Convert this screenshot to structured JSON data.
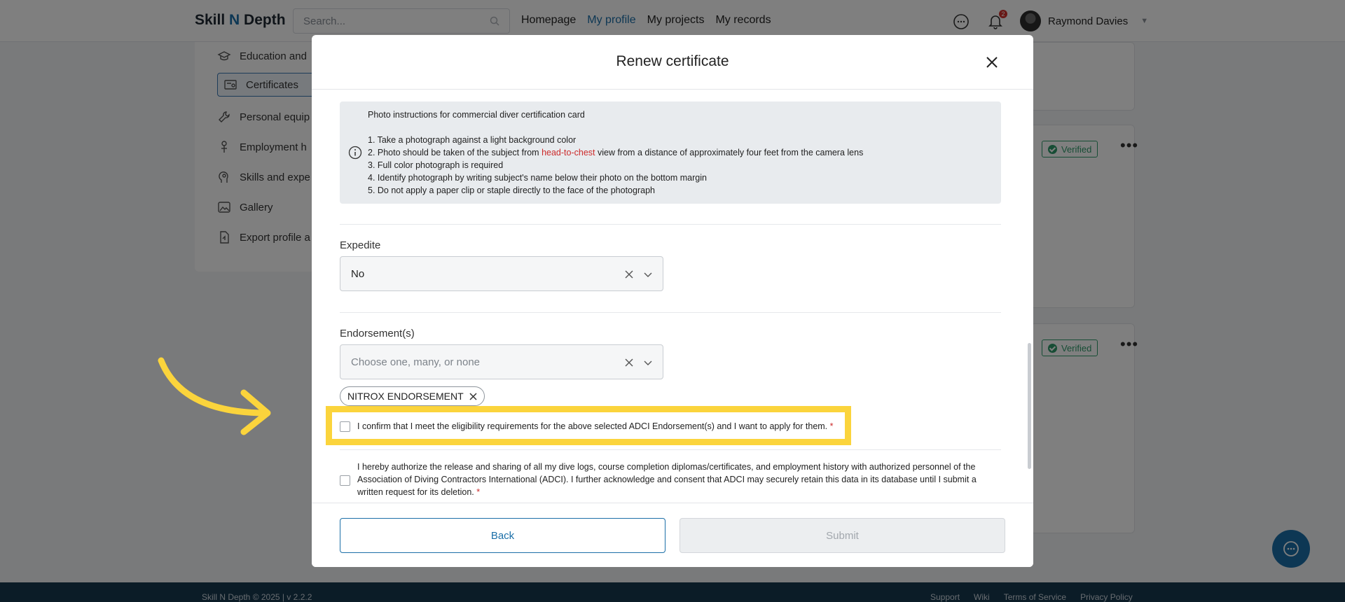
{
  "app": {
    "brand_prefix": "Skill ",
    "brand_n": "N",
    "brand_suffix": " Depth",
    "search_placeholder": "Search...",
    "nav": [
      "Homepage",
      "My profile",
      "My projects",
      "My records"
    ],
    "active_nav": "My profile",
    "notification_count": "2",
    "user_name": "Raymond Davies"
  },
  "sidebar": {
    "items": [
      {
        "label": "Education and",
        "icon": "graduation-cap-icon"
      },
      {
        "label": "Certificates",
        "icon": "certificate-icon"
      },
      {
        "label": "Personal equip",
        "icon": "wrench-icon"
      },
      {
        "label": "Employment h",
        "icon": "briefcase-icon"
      },
      {
        "label": "Skills and expe",
        "icon": "skills-head-icon"
      },
      {
        "label": "Gallery",
        "icon": "image-icon"
      },
      {
        "label": "Export profile a",
        "icon": "export-icon"
      }
    ]
  },
  "cards": {
    "badge_label": "Verified",
    "more_label": "•••"
  },
  "modal": {
    "title": "Renew certificate",
    "info": {
      "title": "Photo instructions for commercial diver certification card",
      "line1": "1. Take a photograph against a light background color",
      "line2_pre": "2. Photo should be taken of the subject from ",
      "line2_red": "head-to-chest",
      "line2_post": " view from a distance of approximately four feet from the camera lens",
      "line3": "3. Full color photograph is required",
      "line4": "4. Identify photograph by writing subject's name below their photo on the bottom margin",
      "line5": "5. Do not apply a paper clip or staple directly to the face of the photograph"
    },
    "expedite": {
      "label": "Expedite",
      "value": "No"
    },
    "endorsements": {
      "label": "Endorsement(s)",
      "placeholder": "Choose one, many, or none",
      "selected_chip": "NITROX ENDORSEMENT"
    },
    "confirm_eligibility": {
      "text": "I confirm that I meet the eligibility requirements for the above selected ADCI Endorsement(s) and I want to apply for them.",
      "required_mark": "*"
    },
    "authorize_release": {
      "text": "I hereby authorize the release and sharing of all my dive logs, course completion diplomas/certificates, and employment history with authorized personnel of the Association of Diving Contractors International (ADCI). I further acknowledge and consent that ADCI may securely retain this data in its database until I submit a written request for its deletion.",
      "required_mark": "*"
    },
    "back_label": "Back",
    "submit_label": "Submit"
  },
  "footer": {
    "copyright": "Skill N Depth © 2025 | v 2.2.2",
    "links": [
      "Support",
      "Wiki",
      "Terms of Service",
      "Privacy Policy"
    ]
  },
  "colors": {
    "brand_blue": "#1b6fa8",
    "highlight_yellow": "#fbd43c",
    "verified_green": "#2f9a6b",
    "required_red": "#cc2b2b"
  }
}
